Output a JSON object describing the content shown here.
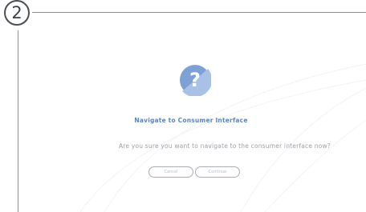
{
  "step": {
    "number": "2"
  },
  "dialog": {
    "title": "Navigate to Consumer Interface",
    "message": "Are you sure you want to navigate to the consumer interface now?",
    "cancel_label": "Cancel",
    "continue_label": "Continue",
    "icon": "question-mark-icon"
  },
  "colors": {
    "accent": "#5b84c0",
    "icon_fill": "#7da1d4",
    "frame": "#8a8f95",
    "muted_text": "#9aa0a6"
  }
}
